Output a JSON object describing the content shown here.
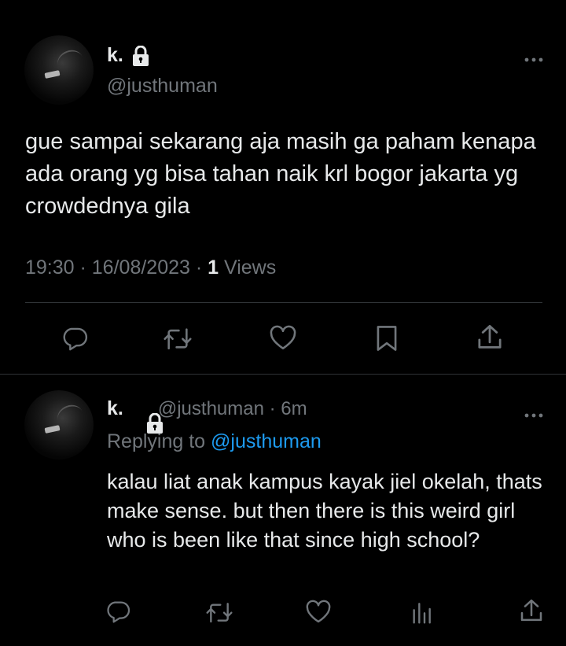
{
  "tweet": {
    "display_name": "k.",
    "handle": "@justhuman",
    "text": "gue sampai sekarang aja masih ga paham kenapa ada orang yg bisa tahan naik krl bogor jakarta yg crowdednya gila",
    "time": "19:30",
    "separator": " · ",
    "date": "16/08/2023",
    "views_count": "1",
    "views_label": " Views"
  },
  "reply": {
    "display_name": "k.",
    "handle": "@justhuman",
    "age": "6m",
    "replying_prefix": "Replying to ",
    "replying_to": "@justhuman",
    "text": "kalau liat anak kampus kayak jiel okelah, thats make sense. but then there is this weird girl who is been like that since high school?"
  },
  "icons": {
    "more": "more-dots-icon",
    "lock": "lock-icon",
    "reply": "reply-bubble-icon",
    "retweet": "retweet-icon",
    "like": "heart-icon",
    "bookmark": "bookmark-icon",
    "share": "share-icon",
    "analytics": "analytics-icon"
  },
  "colors": {
    "background": "#000000",
    "text": "#e7e9ea",
    "secondary": "#71767b",
    "accent": "#1d9bf0",
    "divider": "#2f3336"
  }
}
